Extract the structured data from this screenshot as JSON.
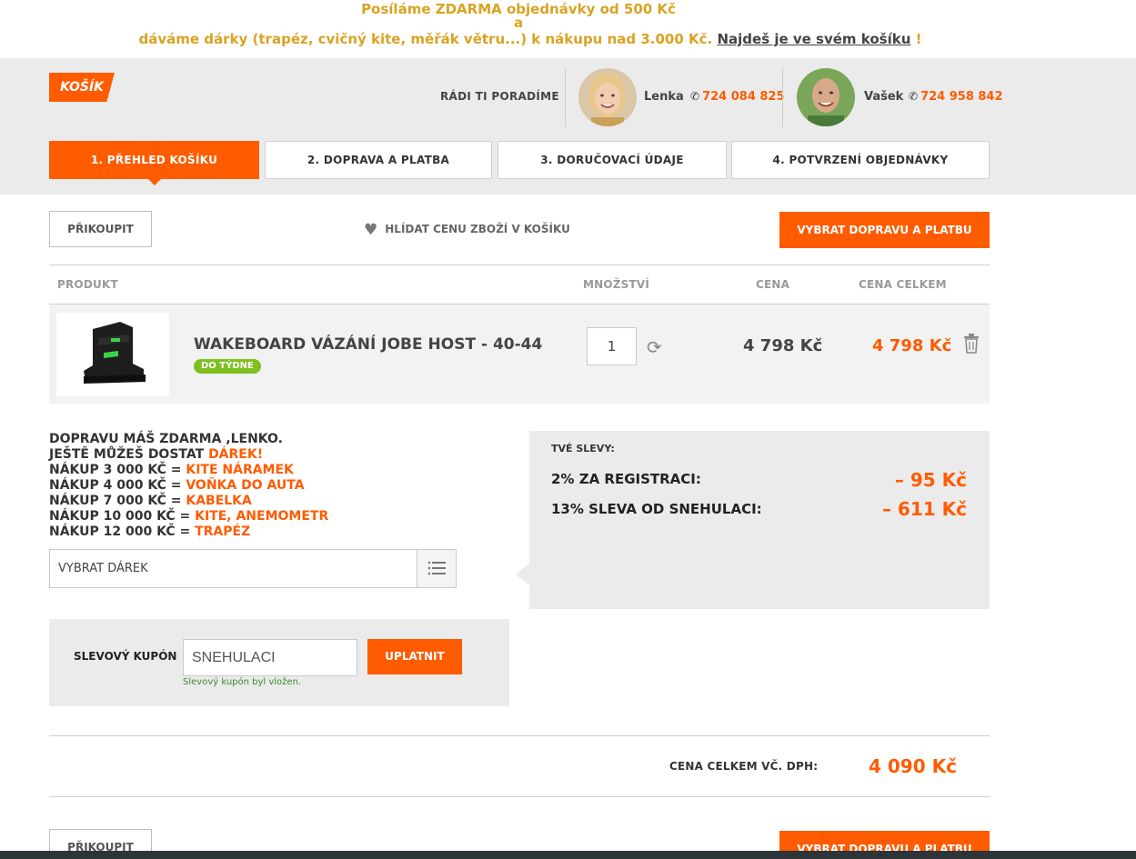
{
  "promo": {
    "line1": "Posíláme ZDARMA objednávky od 500 Kč",
    "line2": "a",
    "line3_text": "dáváme dárky (trapéz, cvičný kite, měřák větru...) k nákupu nad 3.000 Kč.",
    "line3_link": "Najdeš je ve svém košíku",
    "line3_end": "!"
  },
  "header": {
    "cart_badge": "KOŠÍK",
    "advice_label": "RÁDI TI PORADÍME",
    "contacts": [
      {
        "name": "Lenka",
        "phone": "724 084 825"
      },
      {
        "name": "Vašek",
        "phone": "724 958 842"
      }
    ]
  },
  "steps": [
    {
      "label": "1. PŘEHLED KOŠÍKU",
      "active": true
    },
    {
      "label": "2. DOPRAVA A PLATBA",
      "active": false
    },
    {
      "label": "3. DORUČOVACÍ ÚDAJE",
      "active": false
    },
    {
      "label": "4. POTVRZENÍ OBJEDNÁVKY",
      "active": false
    }
  ],
  "toolbar": {
    "add_more": "PŘIKOUPIT",
    "watch_price": "HLÍDAT CENU ZBOŽÍ V KOŠÍKU",
    "next": "VYBRAT DOPRAVU A PLATBU"
  },
  "table": {
    "headers": {
      "product": "PRODUKT",
      "qty": "MNOŽSTVÍ",
      "price": "CENA",
      "total": "CENA CELKEM"
    },
    "item": {
      "name": "WAKEBOARD VÁZÁNÍ JOBE HOST - 40-44",
      "availability": "DO TÝDNE",
      "qty": "1",
      "price": "4 798 Kč",
      "total": "4 798 Kč"
    }
  },
  "gifts": {
    "line1": "DOPRAVU MÁŠ ZDARMA ,LENKO.",
    "line2_prefix": "JEŠTĚ MŮŽEŠ DOSTAT",
    "line2_highlight": "DÁREK!",
    "tiers": [
      {
        "label": "NÁKUP 3 000 KČ =",
        "gift": "KITE NÁRAMEK"
      },
      {
        "label": "NÁKUP 4 000 KČ =",
        "gift": "VOŇKA DO AUTA"
      },
      {
        "label": "NÁKUP 7 000 KČ =",
        "gift": "KABELKA"
      },
      {
        "label": "NÁKUP 10 000 KČ =",
        "gift": "KITE, ANEMOMETR"
      },
      {
        "label": "NÁKUP 12 000 KČ =",
        "gift": "TRAPÉZ"
      }
    ],
    "select_placeholder": "VYBRAT DÁREK"
  },
  "discounts": {
    "title": "TVÉ SLEVY:",
    "items": [
      {
        "label": "2% ZA REGISTRACI:",
        "value": "– 95 Kč"
      },
      {
        "label": "13% SLEVA OD SNEHULACI:",
        "value": "– 611 Kč"
      }
    ]
  },
  "coupon": {
    "label": "SLEVOVÝ KUPÓN",
    "value": "SNEHULACI",
    "apply": "UPLATNIT",
    "message": "Slevový kupón byl vložen."
  },
  "summary": {
    "total_label": "CENA CELKEM VČ. DPH:",
    "total_value": "4 090 Kč"
  },
  "colors": {
    "accent": "#ff5b00",
    "promo": "#d9a322",
    "band": "#ebebeb",
    "green_badge": "#7fbf1f"
  }
}
